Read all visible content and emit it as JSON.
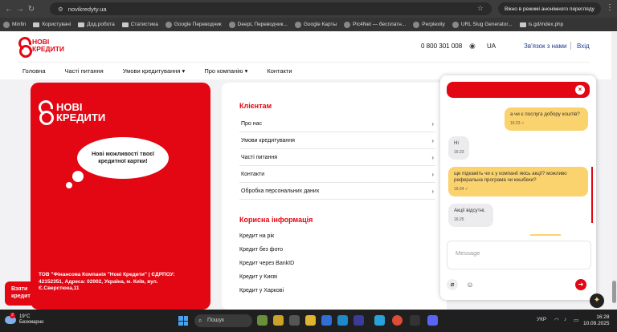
{
  "browser": {
    "url": "novikredyty.ua",
    "incognito_label": "Вікно в режимі анонімного перегляду",
    "bookmarks": [
      "Minfin",
      "Користувачі",
      "Дод.робота",
      "Статистика",
      "Google Переводчик",
      "DeepL Переводчик...",
      "Google Карты",
      "Pic4Net — бесплатн...",
      "Perplexity",
      "URL Slug Generator...",
      "is.gd/index.php"
    ]
  },
  "header": {
    "logo_line1": "НОВІ",
    "logo_line2": "КРЕДИТИ",
    "phone": "0 800 301 008",
    "lang": "UA",
    "contact": "Зв'язок з нами",
    "login": "Вхід"
  },
  "nav": [
    "Головна",
    "Часті питання",
    "Умови кредитування ▾",
    "Про компанію ▾",
    "Контакти"
  ],
  "promo": {
    "logo_line1": "НОВІ",
    "logo_line2": "КРЕДИТИ",
    "cloud_text": "Нові можливості твоєї кредитної картки!",
    "company": "ТОВ \"Фінансова Компанія \"Нові Кредити\" | ЄДРПОУ: 42152351, Адреса: 02002, Україна, м. Київ, вул. Є.Сверстюка,11"
  },
  "clients": {
    "title": "Клієнтам",
    "items": [
      "Про нас",
      "Умови кредитування",
      "Часті питання",
      "Контакти",
      "Обробка персональних даних"
    ]
  },
  "useful": {
    "title": "Корисна інформація",
    "items": [
      "Кредит на рік",
      "Кредит без фото",
      "Кредит через BankID",
      "Кредит у Києві",
      "Кредит у Харкові"
    ]
  },
  "take_credit": "Взяти кредит",
  "chat": {
    "messages": [
      {
        "side": "right",
        "text": "а чи є послуга доборy коштів?",
        "time": "16:23"
      },
      {
        "side": "left",
        "text": "Ні",
        "time": "16:23"
      },
      {
        "side": "right",
        "text": "ще підкажіть чи є у компанії якісь акції? можливо реферальна програма чи кешбеки?",
        "time": "16:24"
      },
      {
        "side": "left",
        "text": "Акції відсутні.",
        "time": "16:25"
      }
    ],
    "placeholder": "Message"
  },
  "taskbar": {
    "temp": "19°C",
    "weather": "Безхмарно",
    "badge": "2",
    "search": "Пошук",
    "lang": "УКР",
    "time": "16:28",
    "date": "10.09.2025"
  }
}
